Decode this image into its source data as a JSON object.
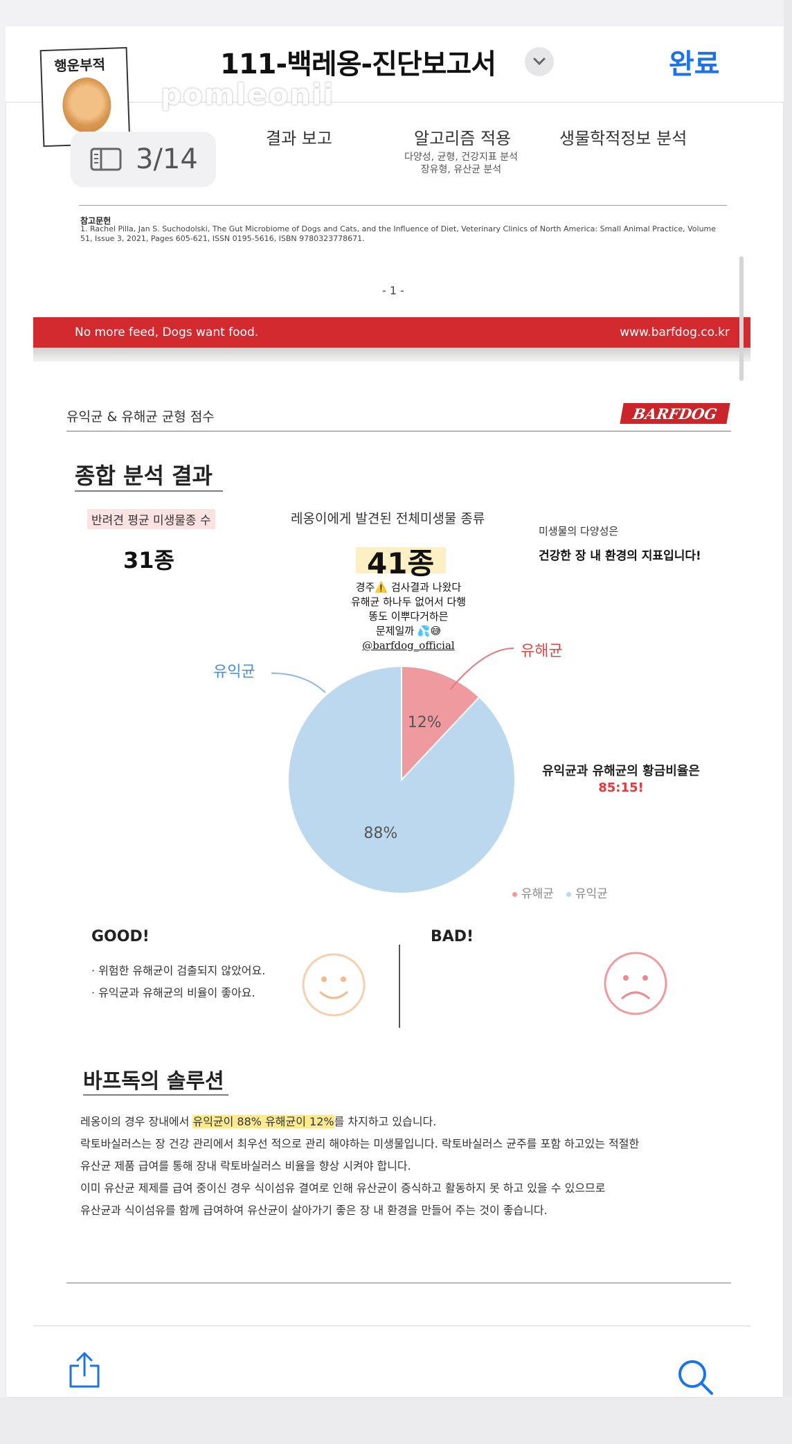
{
  "nav": {
    "title": "111-백레옹-진단보고서",
    "done_label": "완료",
    "page_indicator": "3/14"
  },
  "sticker": {
    "text": "행운부적",
    "watermark": "pomleonii"
  },
  "page1": {
    "col1": "결과 보고",
    "col2": "알고리즘 적용",
    "col2_sub1": "다양성, 균형, 건강지표 분석",
    "col2_sub2": "장유형, 유산균 분석",
    "col3": "생물학적정보 분석",
    "ref_title": "참고문헌",
    "ref_body": "1. Rachel Pilla, Jan S. Suchodolski, The Gut Microbiome of Dogs and Cats, and the Influence of Diet, Veterinary Clinics of North America: Small Animal Practice, Volume 51, Issue 3, 2021, Pages 605-621, ISSN 0195-5616, ISBN 9780323778671.",
    "page_number": "- 1 -",
    "band_left": "No more feed, Dogs want food.",
    "band_right": "www.barfdog.co.kr"
  },
  "page2": {
    "header": "유익균 & 유해균 균형 점수",
    "brand": "BARFDOG",
    "section_title": "종합 분석 결과",
    "avg_label": "반려견 평균 미생물종 수",
    "avg_value": "31종",
    "total_label": "레옹이에게 발견된 전체미생물 종류",
    "total_value": "41종",
    "diversity_line1": "미생물의 다양성은",
    "diversity_line2": "건강한 장 내 환경의 지표입니다!",
    "notes": [
      "경주⚠️ 검사결과 나왔다",
      "유해균 하나두 없어서 다행",
      "똥도 이뿌다거하믄",
      "문제일까 💦😅"
    ],
    "handle": "@barfdog_official",
    "good_label": "유익균",
    "bad_label": "유해균",
    "ratio_line1": "유익균과 유해균의 황금비율은",
    "ratio_value": "85:15!",
    "legend_bad": "유해균",
    "legend_good": "유익균",
    "good_title": "GOOD!",
    "good_items": [
      "· 위험한 유해균이 검출되지 않았어요.",
      "· 유익균과 유해균의 비율이 좋아요."
    ],
    "bad_title": "BAD!",
    "solution_title": "바프독의 솔루션",
    "sol_l1_pre": "레옹이의 경우 장내에서 ",
    "sol_l1_hl": "유익균이 88% 유해균이 12%",
    "sol_l1_post": "를 차지하고 있습니다.",
    "sol_l2": "락토바실러스는 장 건강 관리에서 최우선 적으로 관리 해야하는 미생물입니다. 락토바실러스 균주를 포함 하고있는 적절한",
    "sol_l3": "유산균 제품 급여를 통해 장내 락토바실러스 비율을 향상 시켜야 합니다.",
    "sol_l4": "이미 유산균 제제를 급여 중이신 경우 식이섬유 결여로 인해 유산균이 증식하고 활동하지 못 하고 있을 수 있으므로",
    "sol_l5": "유산균과 식이섬유를 함께 급여하여 유산균이 살아가기 좋은 장 내 환경을 만들어 주는 것이 좋습니다."
  },
  "colors": {
    "good": "#bcd8ee",
    "bad": "#ee9a9f",
    "brand_red": "#d32a2f",
    "link_blue": "#1a73e8"
  },
  "icons": {
    "share": "share-icon",
    "search": "search-icon",
    "chevron": "chevron-down-icon",
    "reader": "sidebar-icon",
    "smile": "smile-face-icon",
    "frown": "sad-face-icon"
  },
  "chart_data": {
    "type": "pie",
    "categories": [
      "유해균",
      "유익균"
    ],
    "values": [
      12,
      88
    ],
    "labels": [
      "12%",
      "88%"
    ],
    "colors": [
      "#ee9a9f",
      "#bcd8ee"
    ],
    "legend": "bottom-right"
  }
}
